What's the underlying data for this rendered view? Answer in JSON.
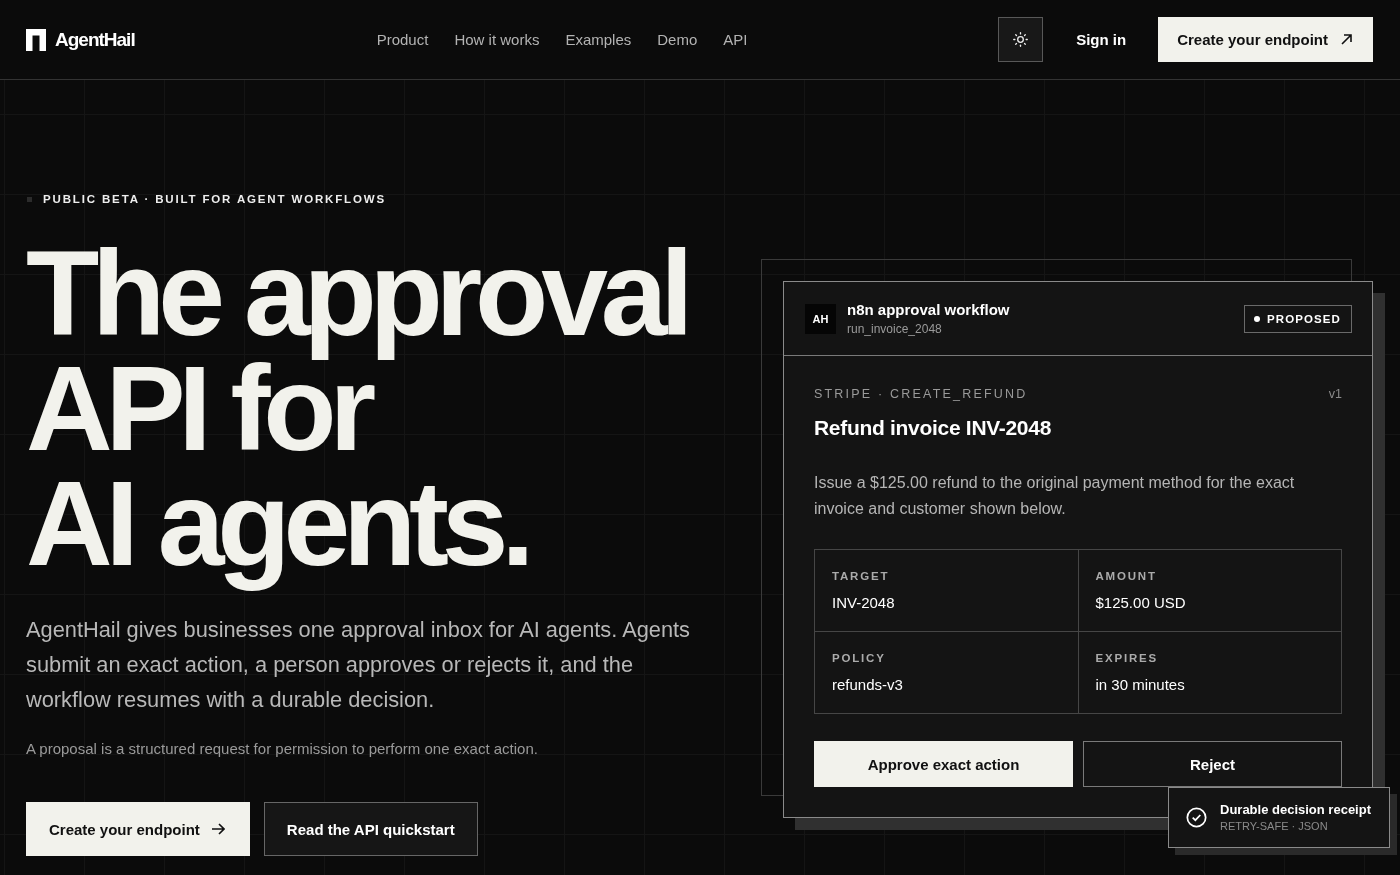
{
  "header": {
    "logo": "AgentHail",
    "nav": [
      "Product",
      "How it works",
      "Examples",
      "Demo",
      "API"
    ],
    "sign_in": "Sign in",
    "cta": "Create your endpoint"
  },
  "hero": {
    "eyebrow": "PUBLIC BETA · BUILT FOR AGENT WORKFLOWS",
    "headline": [
      "The approval",
      "API for",
      "AI agents."
    ],
    "description": "AgentHail gives businesses one approval inbox for AI agents. Agents submit an exact action, a person approves or rejects it, and the workflow resumes with a durable decision.",
    "note": "A proposal is a structured request for permission to perform one exact action.",
    "buttons": [
      {
        "label": "Create your endpoint",
        "kind": "primary"
      },
      {
        "label": "Read the API quickstart",
        "kind": "secondary"
      }
    ]
  },
  "proposal_card": {
    "avatar": "AH",
    "title": "n8n approval workflow",
    "run_id": "run_invoice_2048",
    "status": "PROPOSED",
    "action": "STRIPE · CREATE_REFUND",
    "version": "v1",
    "heading": "Refund invoice INV-2048",
    "description": "Issue a $125.00 refund to the original payment method for the exact invoice and customer shown below.",
    "details": [
      {
        "label": "TARGET",
        "value": "INV-2048"
      },
      {
        "label": "AMOUNT",
        "value": "$125.00 USD"
      },
      {
        "label": "POLICY",
        "value": "refunds-v3"
      },
      {
        "label": "EXPIRES",
        "value": "in 30 minutes"
      }
    ],
    "buttons": [
      {
        "label": "Approve exact action",
        "kind": "primary"
      },
      {
        "label": "Reject",
        "kind": "secondary"
      }
    ]
  },
  "toast": {
    "title": "Durable decision receipt",
    "subtitle": "RETRY-SAFE · JSON"
  }
}
